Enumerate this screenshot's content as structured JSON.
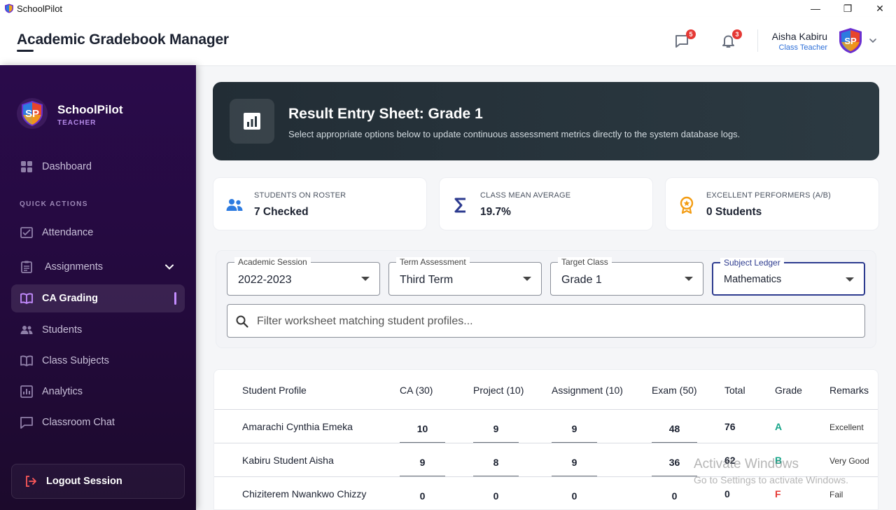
{
  "window": {
    "app_name": "SchoolPilot",
    "minimize": "—",
    "restore": "❐",
    "close": "✕"
  },
  "header": {
    "title": "Academic Gradebook Manager",
    "messages_count": "5",
    "notifications_count": "3",
    "user_name": "Aisha Kabiru",
    "user_role": "Class Teacher",
    "avatar_text": "SP"
  },
  "sidebar": {
    "brand_logo_text": "SP",
    "brand_name": "SchoolPilot",
    "brand_role": "TEACHER",
    "section_label": "QUICK ACTIONS",
    "items": {
      "dashboard": "Dashboard",
      "attendance": "Attendance",
      "assignments": "Assignments",
      "ca_grading": "CA Grading",
      "students": "Students",
      "class_subjects": "Class Subjects",
      "analytics": "Analytics",
      "classroom_chat": "Classroom Chat"
    },
    "logout": "Logout Session",
    "active_color": "#c48cff"
  },
  "hero": {
    "title": "Result Entry Sheet: Grade 1",
    "subtitle": "Select appropriate options below to update continuous assessment metrics directly to the system database logs."
  },
  "stats": [
    {
      "label": "STUDENTS ON ROSTER",
      "value": "7 Checked",
      "icon": "users-icon",
      "color": "#2d7be0"
    },
    {
      "label": "CLASS MEAN AVERAGE",
      "value": "19.7%",
      "icon": "sigma-icon",
      "color": "#2d3b8f"
    },
    {
      "label": "EXCELLENT PERFORMERS (A/B)",
      "value": "0 Students",
      "icon": "award-icon",
      "color": "#f39c12"
    }
  ],
  "filters": {
    "session": {
      "label": "Academic Session",
      "value": "2022-2023"
    },
    "term": {
      "label": "Term Assessment",
      "value": "Third Term"
    },
    "class": {
      "label": "Target Class",
      "value": "Grade 1"
    },
    "subject": {
      "label": "Subject Ledger",
      "value": "Mathematics"
    },
    "search_placeholder": "Filter worksheet matching student profiles..."
  },
  "table": {
    "headers": {
      "student": "Student Profile",
      "ca": "CA (30)",
      "project": "Project (10)",
      "assignment": "Assignment (10)",
      "exam": "Exam (50)",
      "total": "Total",
      "grade": "Grade",
      "remarks": "Remarks"
    },
    "rows": [
      {
        "name": "Amarachi Cynthia Emeka",
        "ca": "10",
        "project": "9",
        "assignment": "9",
        "exam": "48",
        "total": "76",
        "grade": "A",
        "grade_color": "#17a589",
        "remarks": "Excellent"
      },
      {
        "name": "Kabiru Student Aisha",
        "ca": "9",
        "project": "8",
        "assignment": "9",
        "exam": "36",
        "total": "62",
        "grade": "B",
        "grade_color": "#17a589",
        "remarks": "Very Good"
      },
      {
        "name": "Chiziterem Nwankwo Chizzy",
        "ca": "0",
        "project": "0",
        "assignment": "0",
        "exam": "0",
        "total": "0",
        "grade": "F",
        "grade_color": "#e53935",
        "remarks": "Fail"
      }
    ]
  },
  "watermark": {
    "line1": "Activate Windows",
    "line2": "Go to Settings to activate Windows."
  }
}
